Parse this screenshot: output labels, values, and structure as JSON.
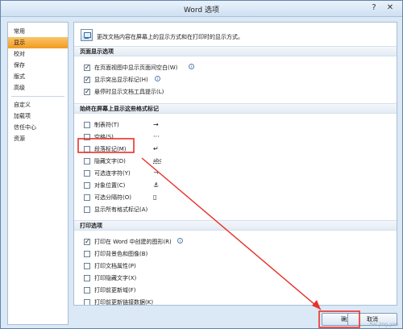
{
  "window": {
    "title": "Word 选项",
    "help_glyph": "?",
    "close_glyph": "✕"
  },
  "sidebar": {
    "items": [
      {
        "label": "常用"
      },
      {
        "label": "显示",
        "selected": true
      },
      {
        "label": "校对"
      },
      {
        "label": "保存"
      },
      {
        "label": "版式"
      },
      {
        "label": "高级"
      },
      {
        "label": "自定义"
      },
      {
        "label": "加载项"
      },
      {
        "label": "信任中心"
      },
      {
        "label": "资源"
      }
    ]
  },
  "intro": {
    "text": "更改文档内容在屏幕上的显示方式和在打印时的显示方式。"
  },
  "sections": {
    "page_display": {
      "header": "页面显示选项",
      "options": [
        {
          "label": "在页面视图中显示页面间空白(W)",
          "checked": true,
          "info": true
        },
        {
          "label": "显示突出显示标记(H)",
          "checked": true,
          "info": true
        },
        {
          "label": "悬停时显示文档工具提示(L)",
          "checked": true
        }
      ]
    },
    "formatting_marks": {
      "header": "始终在屏幕上显示这些格式标记",
      "options": [
        {
          "label": "制表符(T)",
          "checked": false,
          "symbol": "→"
        },
        {
          "label": "空格(S)",
          "checked": false,
          "symbol": "···"
        },
        {
          "label": "段落标记(M)",
          "checked": false,
          "symbol": "↵"
        },
        {
          "label": "隐藏文字(D)",
          "checked": false,
          "symbol": "abc"
        },
        {
          "label": "可选连字符(Y)",
          "checked": false,
          "symbol": "¬"
        },
        {
          "label": "对象位置(C)",
          "checked": false,
          "symbol": "⚓"
        },
        {
          "label": "可选分隔符(O)",
          "checked": false,
          "symbol": "▯"
        },
        {
          "label": "显示所有格式标记(A)",
          "checked": false
        }
      ]
    },
    "print": {
      "header": "打印选项",
      "options": [
        {
          "label": "打印在 Word 中创建的图形(R)",
          "checked": true,
          "info": true
        },
        {
          "label": "打印背景色和图像(B)",
          "checked": false
        },
        {
          "label": "打印文档属性(P)",
          "checked": false
        },
        {
          "label": "打印隐藏文字(X)",
          "checked": false
        },
        {
          "label": "打印前更新域(F)",
          "checked": false
        },
        {
          "label": "打印前更新链接数据(K)",
          "checked": false
        }
      ]
    }
  },
  "footer": {
    "ok_label": "确定",
    "cancel_label": "取消"
  },
  "annotation": {
    "color": "#e8312a"
  },
  "watermark": "Bai jing yan"
}
